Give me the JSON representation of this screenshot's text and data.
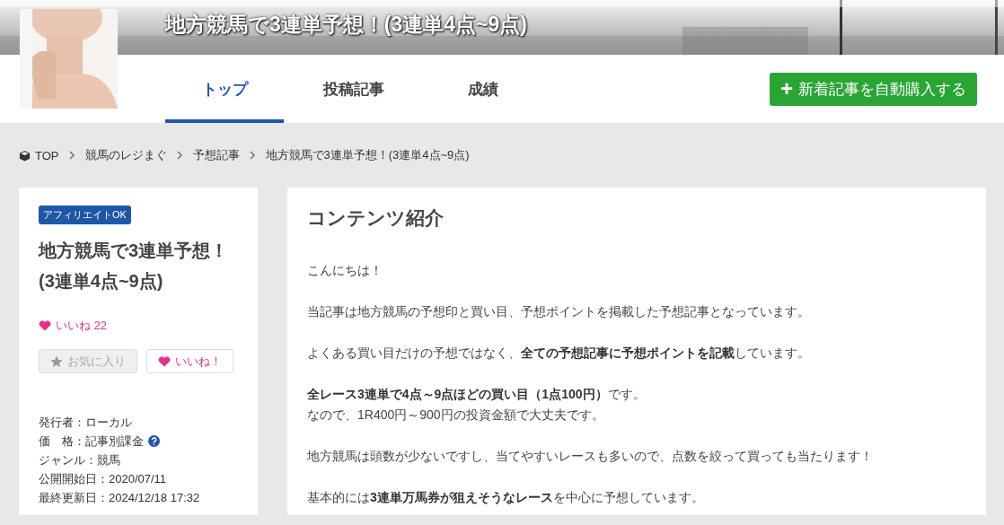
{
  "header": {
    "title": "地方競馬で3連単予想！(3連単4点~9点)",
    "tabs": [
      {
        "label": "トップ",
        "selected": true
      },
      {
        "label": "投稿記事",
        "selected": false
      },
      {
        "label": "成績",
        "selected": false
      }
    ],
    "auto_buy_button": {
      "icon": "+",
      "label": "新着記事を自動購入する"
    }
  },
  "breadcrumb": [
    {
      "label": "TOP"
    },
    {
      "label": "競馬のレジまぐ"
    },
    {
      "label": "予想記事"
    },
    {
      "label": "地方競馬で3連単予想！(3連単4点~9点)"
    }
  ],
  "sidebar": {
    "badge": "アフィリエイトOK",
    "title": "地方競馬で3連単予想！(3連単4点~9点)",
    "likes": {
      "label": "いいね",
      "count": "22"
    },
    "favorite_button": {
      "label": "お気に入り",
      "disabled": true
    },
    "like_button": {
      "label": "いいね！"
    },
    "meta": [
      {
        "text": "発行者：ローカル",
        "help": false
      },
      {
        "text": "価　格：記事別課金",
        "help": true
      },
      {
        "text": "ジャンル：競馬",
        "help": false
      },
      {
        "text": "公開開始日：2020/07/11",
        "help": false
      },
      {
        "text": "最終更新日：2024/12/18 17:32",
        "help": false
      }
    ]
  },
  "content": {
    "heading": "コンテンツ紹介",
    "paragraphs": [
      [
        "こんにちは！"
      ],
      [
        "当記事は地方競馬の予想印と買い目、予想ポイントを掲載した予想記事となっています。"
      ],
      [
        "よくある買い目だけの予想ではなく、**全ての予想記事に予想ポイントを記載**しています。"
      ],
      [
        "**全レース3連単で4点～9点ほどの買い目（1点100円）**です。",
        "なので、1R400円～900円の投資金額で大丈夫です。"
      ],
      [
        "地方競馬は頭数が少ないですし、当てやすいレースも多いので、点数を絞って買っても当たります！"
      ],
      [
        "基本的には**3連単万馬券が狙えそうなレース**を中心に予想しています。"
      ]
    ]
  }
}
